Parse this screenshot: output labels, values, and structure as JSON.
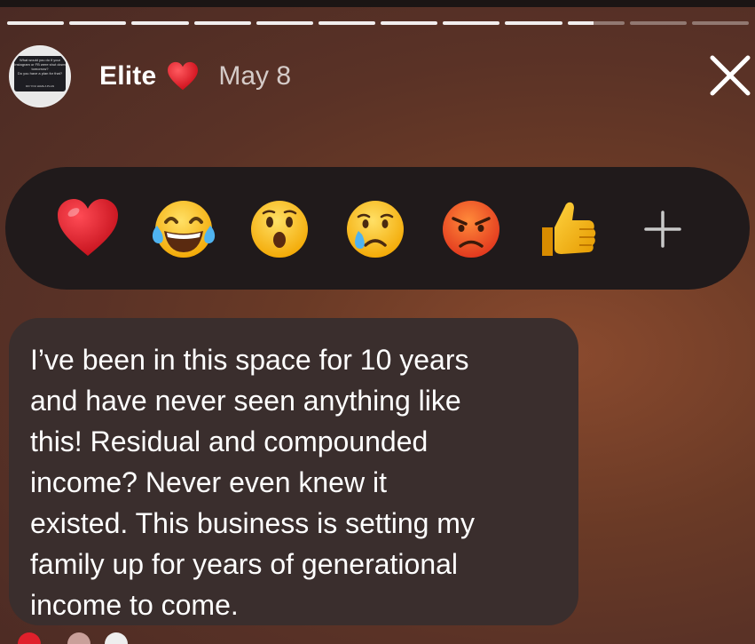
{
  "story": {
    "progress_total_segments": 12,
    "progress_filled_segments": 10
  },
  "header": {
    "username": "Elite",
    "username_emoji": "red-heart",
    "date": "May 8",
    "avatar_text": {
      "line1": "What would you do if your Instagram or FB were shut down tomorrow?",
      "line2": "Do you have a plan for that?",
      "line3": "DO YOU HAVE A PLAN"
    }
  },
  "reactions": {
    "items": [
      "red-heart",
      "tears-of-joy",
      "astonished",
      "crying",
      "angry",
      "thumbs-up",
      "plus"
    ]
  },
  "message": {
    "text": "I’ve been in this space for 10 years\nand have never seen anything like\nthis! Residual and compounded\nincome? Never even knew it\nexisted. This business is setting my\nfamily up for years of generational\nincome to come."
  },
  "colors": {
    "reaction_bar": "#201a1b",
    "bubble": "#3a2e2d",
    "heart": "#e0202b",
    "emoji_yellow": "#f7b500"
  }
}
